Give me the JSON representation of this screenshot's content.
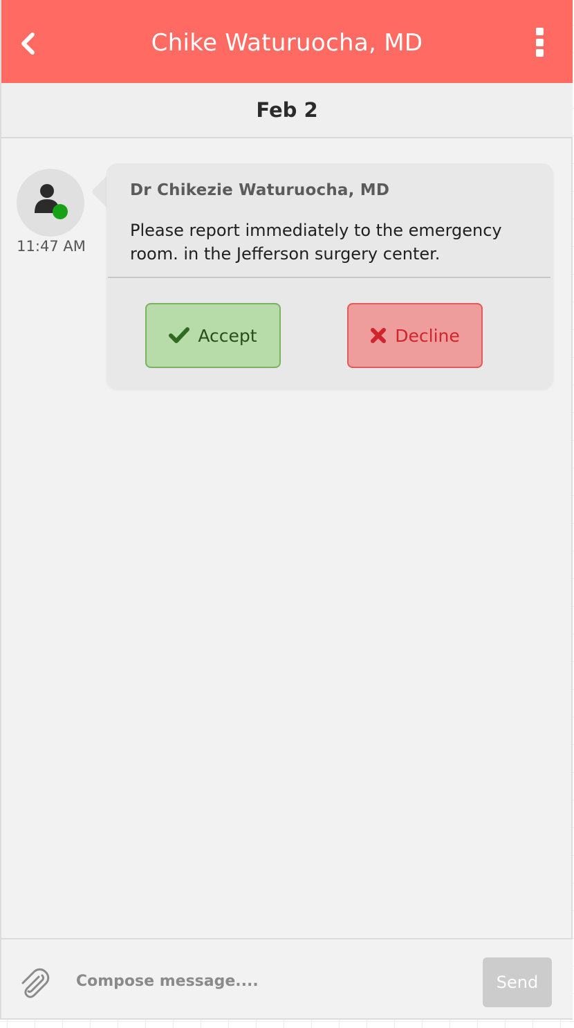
{
  "header": {
    "title": "Chike Waturuocha, MD",
    "back_icon": "chevron-left-icon",
    "menu_icon": "more-vertical-icon",
    "color": "#ff6b63"
  },
  "date_divider": {
    "label": "Feb 2"
  },
  "message": {
    "avatar_icon": "user-icon",
    "status": "online",
    "status_color": "#17a117",
    "time": "11:47 AM",
    "sender": "Dr Chikezie Waturuocha, MD",
    "text": "Please report immediately to the emergency room. in the Jefferson surgery center.",
    "actions": {
      "accept_label": "Accept",
      "accept_icon": "check-icon",
      "decline_label": "Decline",
      "decline_icon": "x-icon"
    }
  },
  "composer": {
    "attach_icon": "paperclip-icon",
    "placeholder": "Compose message....",
    "value": "",
    "send_label": "Send"
  }
}
